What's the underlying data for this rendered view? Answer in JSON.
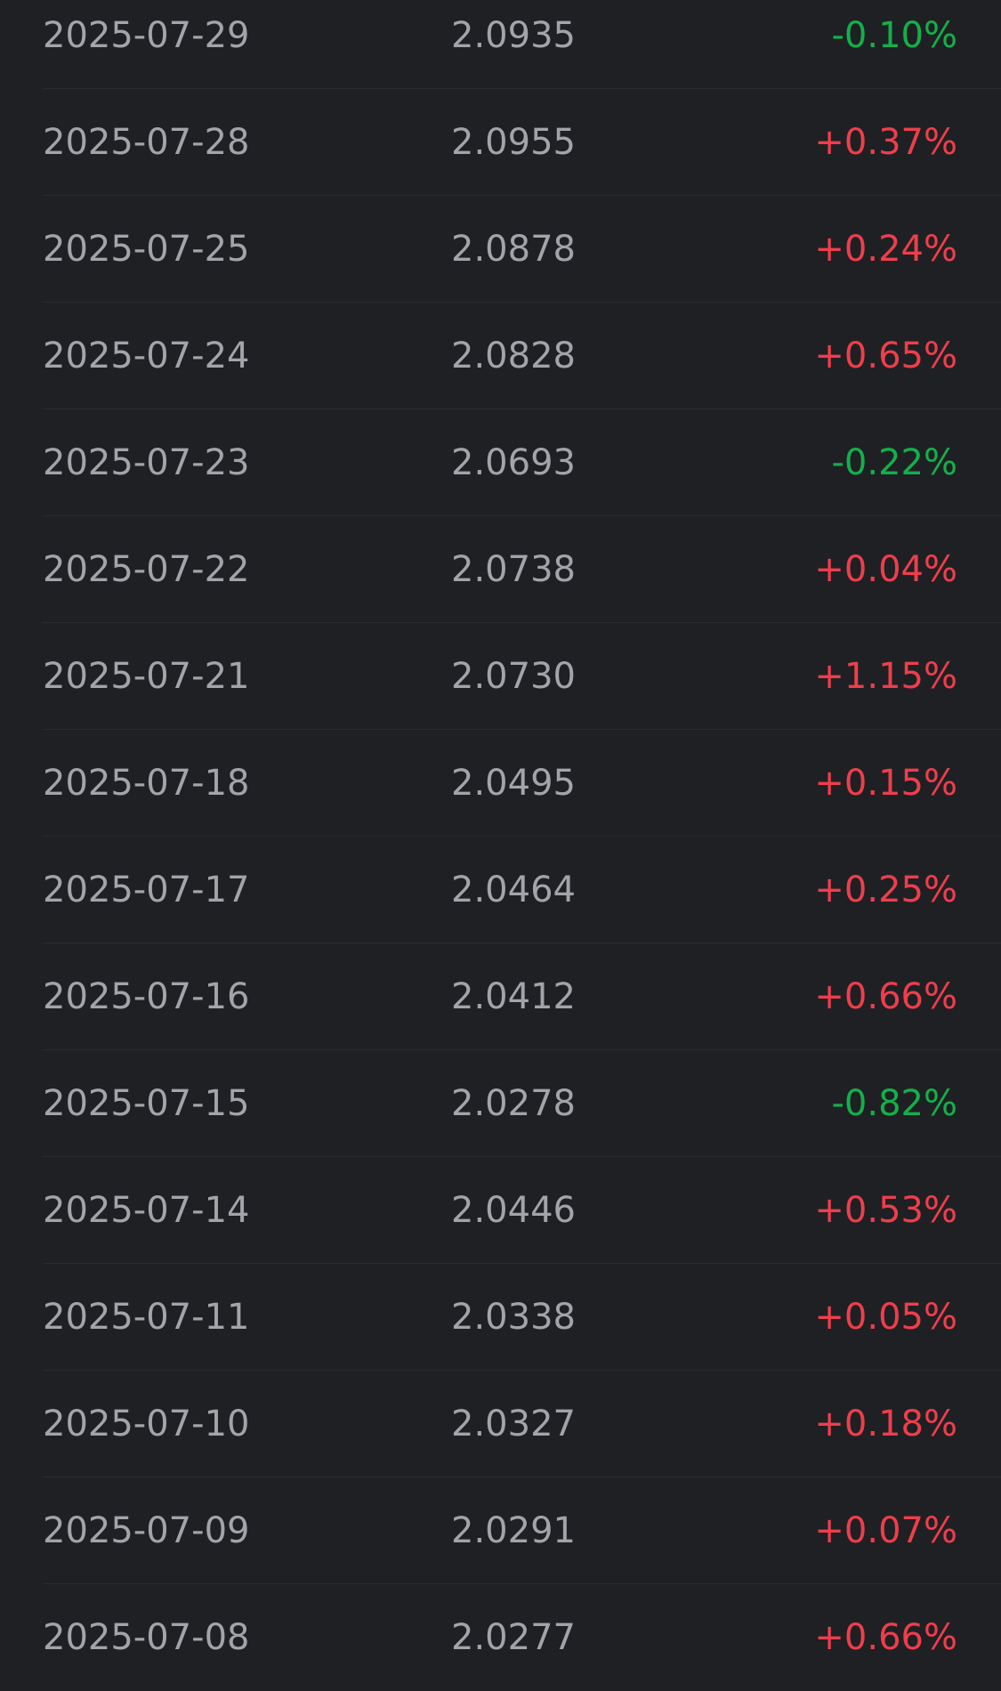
{
  "colors": {
    "background": "#1f2024",
    "text": "#a3a4a9",
    "up": "#ef3e4b",
    "down": "#13b04a",
    "divider": "#2a2b30"
  },
  "rows": [
    {
      "date": "2025-07-29",
      "value": "2.0935",
      "change": "-0.10%",
      "direction": "down"
    },
    {
      "date": "2025-07-28",
      "value": "2.0955",
      "change": "+0.37%",
      "direction": "up"
    },
    {
      "date": "2025-07-25",
      "value": "2.0878",
      "change": "+0.24%",
      "direction": "up"
    },
    {
      "date": "2025-07-24",
      "value": "2.0828",
      "change": "+0.65%",
      "direction": "up"
    },
    {
      "date": "2025-07-23",
      "value": "2.0693",
      "change": "-0.22%",
      "direction": "down"
    },
    {
      "date": "2025-07-22",
      "value": "2.0738",
      "change": "+0.04%",
      "direction": "up"
    },
    {
      "date": "2025-07-21",
      "value": "2.0730",
      "change": "+1.15%",
      "direction": "up"
    },
    {
      "date": "2025-07-18",
      "value": "2.0495",
      "change": "+0.15%",
      "direction": "up"
    },
    {
      "date": "2025-07-17",
      "value": "2.0464",
      "change": "+0.25%",
      "direction": "up"
    },
    {
      "date": "2025-07-16",
      "value": "2.0412",
      "change": "+0.66%",
      "direction": "up"
    },
    {
      "date": "2025-07-15",
      "value": "2.0278",
      "change": "-0.82%",
      "direction": "down"
    },
    {
      "date": "2025-07-14",
      "value": "2.0446",
      "change": "+0.53%",
      "direction": "up"
    },
    {
      "date": "2025-07-11",
      "value": "2.0338",
      "change": "+0.05%",
      "direction": "up"
    },
    {
      "date": "2025-07-10",
      "value": "2.0327",
      "change": "+0.18%",
      "direction": "up"
    },
    {
      "date": "2025-07-09",
      "value": "2.0291",
      "change": "+0.07%",
      "direction": "up"
    },
    {
      "date": "2025-07-08",
      "value": "2.0277",
      "change": "+0.66%",
      "direction": "up"
    }
  ]
}
